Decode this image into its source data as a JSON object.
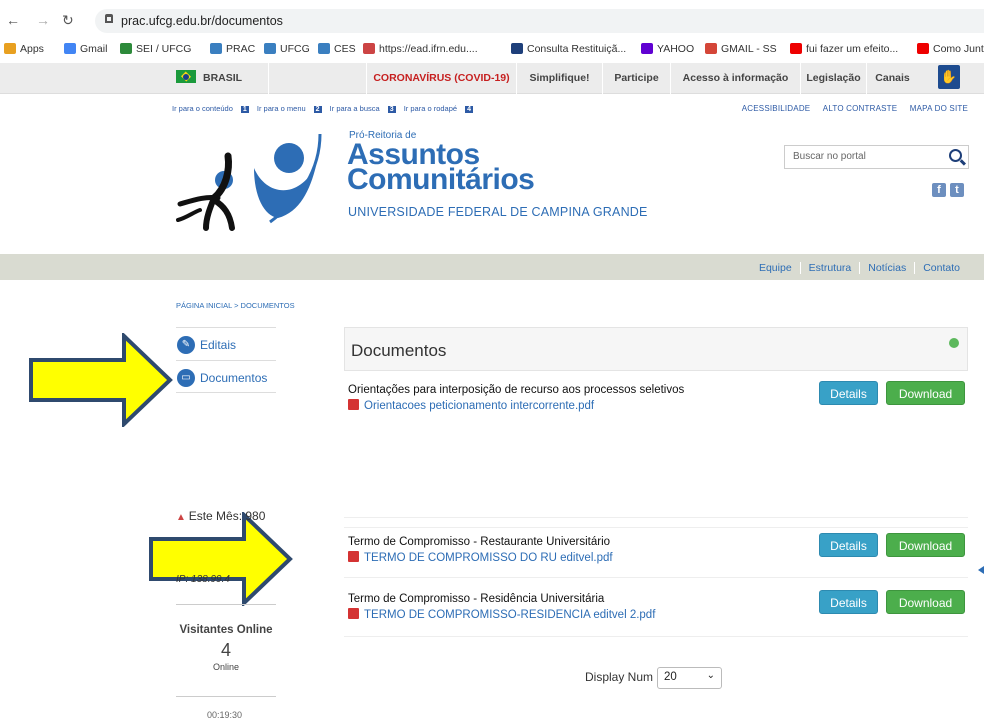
{
  "browser": {
    "url": "prac.ufcg.edu.br/documentos",
    "bookmarks": [
      "Apps",
      "Gmail",
      "SEI / UFCG",
      "PRAC",
      "UFCG",
      "CES",
      "https://ead.ifrn.edu....",
      "Consulta Restituiçã...",
      "YAHOO",
      "GMAIL - SS",
      "fui fazer um efeito...",
      "Como Junt"
    ]
  },
  "govbar": {
    "brasil": "BRASIL",
    "items": [
      "CORONAVÍRUS (COVID-19)",
      "Simplifique!",
      "Participe",
      "Acesso à informação",
      "Legislação",
      "Canais"
    ]
  },
  "skip_links": {
    "items": [
      {
        "label": "Ir para o conteúdo",
        "key": "1"
      },
      {
        "label": "Ir para o menu",
        "key": "2"
      },
      {
        "label": "Ir para a busca",
        "key": "3"
      },
      {
        "label": "Ir para o rodapé",
        "key": "4"
      }
    ],
    "access": [
      "ACESSIBILIDADE",
      "ALTO CONTRASTE",
      "MAPA DO SITE"
    ]
  },
  "header": {
    "subtitle": "Pró-Reitoria de",
    "title_line1": "Assuntos",
    "title_line2": "Comunitários",
    "university": "UNIVERSIDADE FEDERAL DE CAMPINA GRANDE",
    "search_placeholder": "Buscar no portal"
  },
  "subnav": [
    "Equipe",
    "Estrutura",
    "Notícias",
    "Contato"
  ],
  "breadcrumb": "PÁGINA INICIAL > DOCUMENTOS",
  "sidebar": {
    "items": [
      {
        "label": "Editais",
        "icon": "tag-icon"
      },
      {
        "label": "Documentos",
        "icon": "folder-icon"
      }
    ]
  },
  "main": {
    "heading": "Documentos",
    "documents": [
      {
        "title": "Orientações para interposição de recurso aos processos seletivos",
        "file": "Orientacoes peticionamento intercorrente.pdf"
      },
      {
        "title": "Termo de Compromisso - Restaurante Universitário",
        "file": "TERMO DE COMPROMISSO DO RU editvel.pdf"
      },
      {
        "title": "Termo de Compromisso - Residência Universitária",
        "file": "TERMO DE COMPROMISSO-RESIDENCIA editvel 2.pdf"
      }
    ],
    "details_label": "Details",
    "download_label": "Download",
    "display_label": "Display Num",
    "display_value": "20"
  },
  "stats": {
    "month": "Este Mês: 980",
    "ip": "IP: 138.99.4",
    "visitors_title": "Visitantes Online",
    "visitors_count": "4",
    "visitors_label": "Online",
    "time": "00:19:30"
  },
  "colors": {
    "accent": "#2d6db5",
    "arrow_fill": "#ffff00",
    "arrow_stroke": "#2f4a6e"
  }
}
